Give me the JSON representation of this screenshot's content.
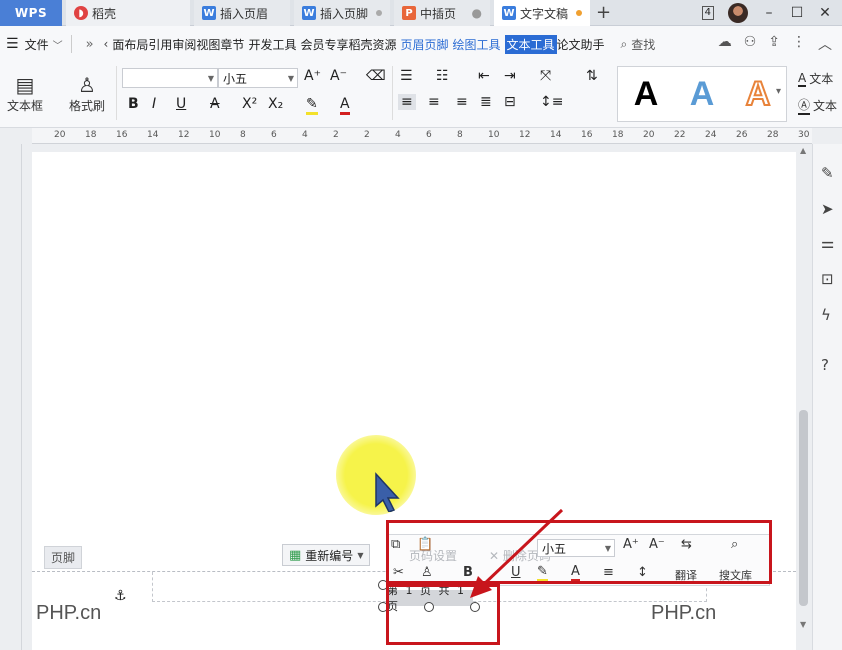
{
  "tabs": [
    {
      "label": "WPS"
    },
    {
      "label": "稻壳",
      "icon": "daoke-icon"
    },
    {
      "label": "插入页眉",
      "icon": "writer-icon"
    },
    {
      "label": "插入页脚",
      "icon": "writer-icon"
    },
    {
      "label": "中插页",
      "icon": "presentation-icon"
    },
    {
      "label": "文字文稿",
      "icon": "writer-icon"
    }
  ],
  "titlebar": {
    "badge": "4"
  },
  "menu": {
    "file": "文件",
    "items": [
      "面布局",
      "引用",
      "审阅",
      "视图",
      "章节",
      "开发工具",
      "会员专享",
      "稻壳资源"
    ],
    "context_items": [
      "页眉页脚",
      "绘图工具"
    ],
    "active": "文本工具",
    "after_active": "论文助手",
    "search": "查找"
  },
  "ribbon": {
    "textbox": "文本框",
    "format_painter": "格式刷",
    "font_name": "",
    "font_size": "小五",
    "style_glyph": "A",
    "side_items": [
      "文本",
      "文本"
    ]
  },
  "ruler": {
    "ticks": [
      "20",
      "18",
      "16",
      "14",
      "12",
      "10",
      "8",
      "6",
      "4",
      "2",
      "2",
      "4",
      "6",
      "8",
      "10",
      "12",
      "14",
      "16",
      "18",
      "20",
      "22",
      "24",
      "26",
      "28",
      "30"
    ]
  },
  "footer": {
    "label": "页脚",
    "renumber": "重新编号",
    "page_number_text": "第 1 页 共 1 页"
  },
  "mini_toolbar": {
    "page_setting": "页码设置",
    "delete_page_number": "删除页码",
    "font_size": "小五",
    "translate": "翻译",
    "search_lib": "搜文库"
  },
  "watermark": {
    "text": "PHP.cn"
  },
  "colors": {
    "accent": "#2b6cd4",
    "annotation": "#c8151c",
    "highlight": "#f6f34a"
  }
}
